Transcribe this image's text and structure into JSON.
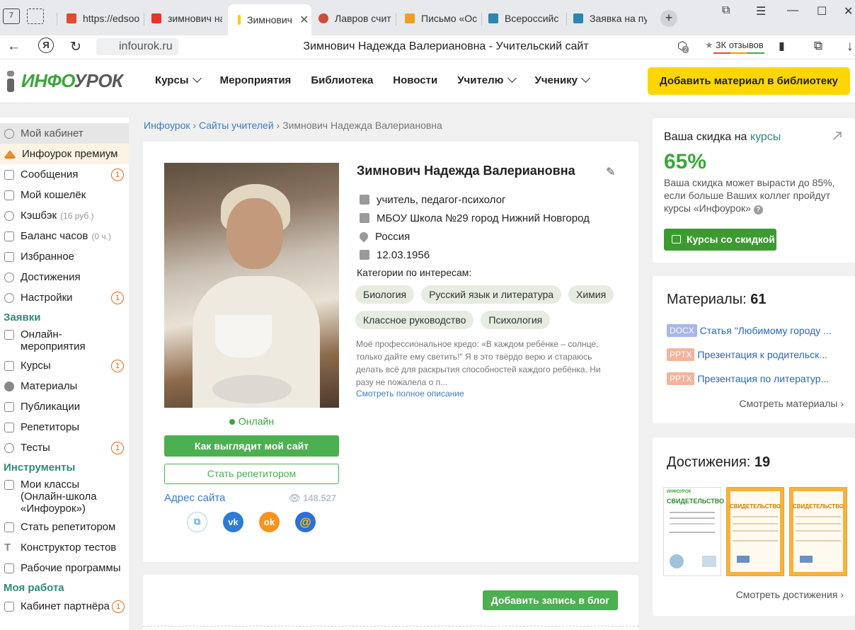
{
  "browser": {
    "tab_count": "7",
    "tabs": [
      {
        "label": "https://edsoo",
        "color": "#e04a2e"
      },
      {
        "label": "зимнович на",
        "color": "#e9362b"
      },
      {
        "label": "Зимнович",
        "color": "#ffcc00",
        "active": true
      },
      {
        "label": "Лавров счит",
        "color": "#d04a3a"
      },
      {
        "label": "Письмо «Ос",
        "color": "#f0a020"
      },
      {
        "label": "Всероссийс",
        "color": "#2a87b0"
      },
      {
        "label": "Заявка на пу",
        "color": "#2a87b0"
      }
    ],
    "url": "infourok.ru",
    "page_title": "Зимнович Надежда Валериановна - Учительский сайт",
    "reviews_label": "3К отзывов",
    "badge_count": "2"
  },
  "header": {
    "logo_green": "ИНФО",
    "logo_gray": "УРОК",
    "nav": [
      {
        "label": "Курсы",
        "dropdown": true
      },
      {
        "label": "Мероприятия",
        "dropdown": false
      },
      {
        "label": "Библиотека",
        "dropdown": false
      },
      {
        "label": "Новости",
        "dropdown": false
      },
      {
        "label": "Учителю",
        "dropdown": true
      },
      {
        "label": "Ученику",
        "dropdown": true
      }
    ],
    "add_button": "Добавить материал в библиотеку"
  },
  "sidebar": {
    "items": [
      {
        "label": "Мой кабинет",
        "icon": "user-icon",
        "state": "selected"
      },
      {
        "label": "Инфоурок премиум",
        "icon": "crown-icon",
        "state": "premium"
      },
      {
        "label": "Сообщения",
        "icon": "mail-icon",
        "badge": "1"
      },
      {
        "label": "Мой кошелёк",
        "icon": "wallet-icon"
      },
      {
        "label": "Кэшбэк",
        "icon": "cashback-icon",
        "small": "(16 руб.)"
      },
      {
        "label": "Баланс часов",
        "icon": "clock-icon",
        "small": "(0 ч.)"
      },
      {
        "label": "Избранное",
        "icon": "bookmark-icon"
      },
      {
        "label": "Достижения",
        "icon": "trophy-icon"
      },
      {
        "label": "Настройки",
        "icon": "gear-icon",
        "badge": "1"
      }
    ],
    "section_requests": "Заявки",
    "requests": [
      {
        "label": "Онлайн-мероприятия",
        "icon": "monitor-icon"
      },
      {
        "label": "Курсы",
        "icon": "cap-icon",
        "badge": "1"
      },
      {
        "label": "Материалы",
        "icon": "star-icon"
      },
      {
        "label": "Публикации",
        "icon": "book-icon"
      },
      {
        "label": "Репетиторы",
        "icon": "people-icon"
      },
      {
        "label": "Тесты",
        "icon": "check-icon",
        "badge": "1"
      }
    ],
    "section_tools": "Инструменты",
    "tools": [
      {
        "label": "Мои классы (Онлайн-школа «Инфоурок»)",
        "icon": "classes-icon"
      },
      {
        "label": "Стать репетитором",
        "icon": "tutor-icon"
      },
      {
        "label": "Конструктор тестов",
        "icon": "text-icon"
      },
      {
        "label": "Рабочие программы",
        "icon": "calendar-icon"
      }
    ],
    "section_work": "Моя работа",
    "work": [
      {
        "label": "Кабинет партнёра",
        "icon": "partner-icon",
        "badge": "1"
      }
    ]
  },
  "breadcrumb": {
    "home": "Инфоурок",
    "section": "Сайты учителей",
    "current": "Зимнович Надежда Валериановна",
    "sep": "›"
  },
  "profile": {
    "name": "Зимнович Надежда Валериановна",
    "position": "учитель, педагог-психолог",
    "school": "МБОУ Школа №29 город Нижний Новгород",
    "country": "Россия",
    "birthdate": "12.03.1956",
    "online": "Онлайн",
    "btn_site": "Как выглядит мой сайт",
    "btn_tutor": "Стать репетитором",
    "site_address": "Адрес сайта",
    "views": "148.527",
    "categories_label": "Категории по интересам:",
    "categories": [
      "Биология",
      "Русский язык и литература",
      "Химия",
      "Классное руководство",
      "Психология"
    ],
    "credo": "Моё профессиональное кредо: «В каждом ребёнке – солнце, только дайте ему светить!\" Я в это твёрдо верю и стараюсь делать всё для раскрытия способностей каждого ребёнка. Ни разу не пожалела о п...",
    "see_full": "Смотреть полное описание"
  },
  "socials": [
    {
      "name": "share-icon",
      "glyph": "⧉",
      "color": "#ffffff",
      "text": "#6fb3e0"
    },
    {
      "name": "vk-icon",
      "glyph": "vk",
      "color": "#2c7bd6",
      "text": "#ffffff"
    },
    {
      "name": "ok-icon",
      "glyph": "ok",
      "color": "#f7931e",
      "text": "#ffffff"
    },
    {
      "name": "mail-ru-icon",
      "glyph": "@",
      "color": "#2c6fd6",
      "text": "#ffcc00"
    }
  ],
  "blog": {
    "add_post": "Добавить запись в блог"
  },
  "discount": {
    "title_prefix": "Ваша скидка на",
    "title_link": "курсы",
    "percent": "65%",
    "text": "Ваша скидка может вырасти до 85%, если больше Ваших коллег пройдут курсы «Инфоурок»",
    "button": "Курсы со скидкой"
  },
  "materials": {
    "title": "Материалы:",
    "count": "61",
    "items": [
      {
        "tag": "DOCX",
        "tag_color": "#a8b5ee",
        "label": "Статья \"Любимому городу ..."
      },
      {
        "tag": "PPTX",
        "tag_color": "#f4b39a",
        "label": "Презентация к родительск..."
      },
      {
        "tag": "PPTX",
        "tag_color": "#f4b39a",
        "label": "Презентация по литератур..."
      }
    ],
    "see_more": "Смотреть материалы ›"
  },
  "achievements": {
    "title": "Достижения:",
    "count": "19",
    "cert_white_title": "СВИДЕТЕЛЬСТВО",
    "cert_orange_title": "СВИДЕТЕЛЬСТВО",
    "see_more": "Смотреть достижения ›"
  }
}
